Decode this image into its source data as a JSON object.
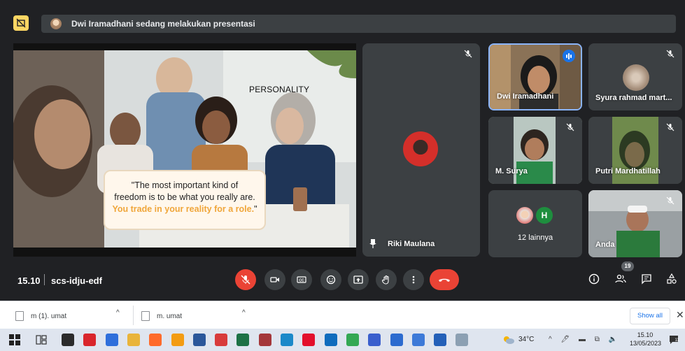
{
  "banner": {
    "text": "Dwi Iramadhani sedang melakukan presentasi"
  },
  "slide": {
    "title": "PERSONALITY",
    "quote_line1": "\"The most important kind of",
    "quote_line2": "freedom is to be what you really are.",
    "quote_highlight": "You trade in your reality for a role.",
    "quote_end": "\""
  },
  "participants": {
    "pinned": "Riki Maulana",
    "tiles": [
      {
        "name": "Dwi Iramadhani",
        "speaking": true
      },
      {
        "name": "Syura rahmad mart..."
      },
      {
        "name": "M. Surya"
      },
      {
        "name": "Putri Mardhatillah"
      },
      {
        "name": "12 lainnya",
        "avatar_letter": "H"
      },
      {
        "name": "Anda"
      }
    ]
  },
  "controls": {
    "time": "15.10",
    "meeting_code": "scs-idju-edf",
    "participant_count": "19",
    "buttons": [
      "mic-off",
      "camera",
      "captions",
      "reactions",
      "present",
      "raise-hand",
      "more-options",
      "leave-call"
    ],
    "right_buttons": [
      "info",
      "people",
      "chat",
      "activities"
    ]
  },
  "downloads": {
    "items": [
      "m (1). umat",
      "m. umat"
    ],
    "caret": "^",
    "show_all": "Show all",
    "close": "✕"
  },
  "taskbar": {
    "temperature": "34°C",
    "time": "15.10",
    "date": "13/05/2023",
    "tray": "^ 🖊 ▬ ⧉ 🔈",
    "apps": [
      {
        "name": "widgets",
        "color": "#2b2b2b"
      },
      {
        "name": "acrobat",
        "color": "#d9262c"
      },
      {
        "name": "store",
        "color": "#2f6fdb"
      },
      {
        "name": "file-explorer",
        "color": "#e9b43a"
      },
      {
        "name": "firefox",
        "color": "#ff6b2b"
      },
      {
        "name": "vlc",
        "color": "#f39c12"
      },
      {
        "name": "word",
        "color": "#2b579a"
      },
      {
        "name": "app-red",
        "color": "#d83b3b"
      },
      {
        "name": "excel",
        "color": "#1d7145"
      },
      {
        "name": "access",
        "color": "#a4373a"
      },
      {
        "name": "edge",
        "color": "#1b89c9"
      },
      {
        "name": "opera",
        "color": "#e3102c"
      },
      {
        "name": "outlook",
        "color": "#0f6cbd"
      },
      {
        "name": "chrome",
        "color": "#34a853"
      },
      {
        "name": "app-blue-1",
        "color": "#3a5fcd"
      },
      {
        "name": "app-blue-2",
        "color": "#2c6bcf"
      },
      {
        "name": "app-blue-3",
        "color": "#3d7ad8"
      },
      {
        "name": "app-blue-4",
        "color": "#2460b8"
      },
      {
        "name": "app-gray",
        "color": "#8ca0b3"
      }
    ]
  },
  "colors": {
    "background": "#202124",
    "tile": "#3c4043",
    "danger": "#ea4335",
    "accent": "#8ab4f8",
    "highlight": "#f0a63a"
  }
}
